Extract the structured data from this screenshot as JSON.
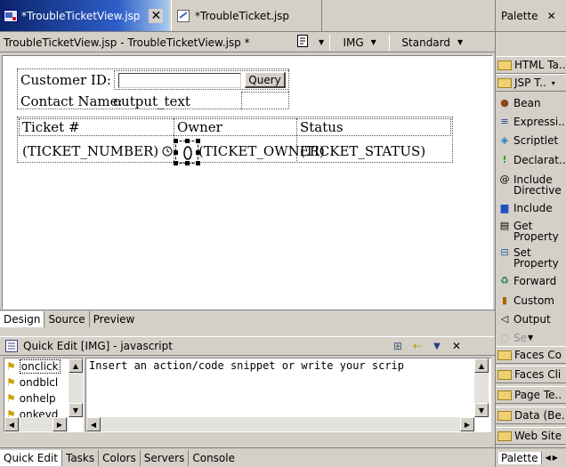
{
  "editor_tabs": [
    {
      "label": "*TroubleTicketView.jsp",
      "active": true
    },
    {
      "label": "*TroubleTicket.jsp",
      "active": false
    }
  ],
  "toolbar": {
    "title": "TroubleTicketView.jsp - TroubleTicketView.jsp *",
    "img_label": "IMG",
    "standard_label": "Standard"
  },
  "design": {
    "customer_id_label": "Customer ID:",
    "query_button": "Query",
    "contact_name_label": "Contact Name:",
    "contact_name_value": "output_text",
    "headers": [
      "Ticket #",
      "Owner",
      "Status"
    ],
    "row": [
      "(TICKET_NUMBER)",
      "(TICKET_OWNER)",
      "(TICKET_STATUS)"
    ]
  },
  "view_tabs": [
    "Design",
    "Source",
    "Preview"
  ],
  "quick_edit": {
    "title": "Quick Edit [IMG] - javascript",
    "events": [
      "onclick",
      "ondblcl",
      "onhelp",
      "onkeyd"
    ],
    "placeholder": "Insert an action/code snippet or write your scrip"
  },
  "bottom_tabs": [
    "Quick Edit",
    "Tasks",
    "Colors",
    "Servers",
    "Console"
  ],
  "palette": {
    "title": "Palette",
    "drawers_top": [
      "HTML Ta..",
      "JSP T.."
    ],
    "items": [
      {
        "label": "Bean",
        "icon": "bean-icon"
      },
      {
        "label": "Expressi..",
        "icon": "expression-icon"
      },
      {
        "label": "Scriptlet",
        "icon": "scriptlet-icon"
      },
      {
        "label": "Declarat..",
        "icon": "declaration-icon"
      },
      {
        "label": "Include Directive",
        "icon": "include-directive-icon"
      },
      {
        "label": "Include",
        "icon": "include-icon"
      },
      {
        "label": "Get Property",
        "icon": "get-property-icon"
      },
      {
        "label": "Set Property",
        "icon": "set-property-icon"
      },
      {
        "label": "Forward",
        "icon": "forward-icon"
      },
      {
        "label": "Custom",
        "icon": "custom-icon"
      },
      {
        "label": "Output",
        "icon": "output-icon"
      },
      {
        "label": "Se",
        "icon": "select-icon"
      }
    ],
    "drawers_bottom": [
      "Faces Co",
      "Faces Cli",
      "Page Te..",
      "Data (Be..",
      "Web Site"
    ],
    "footer": "Palette"
  }
}
